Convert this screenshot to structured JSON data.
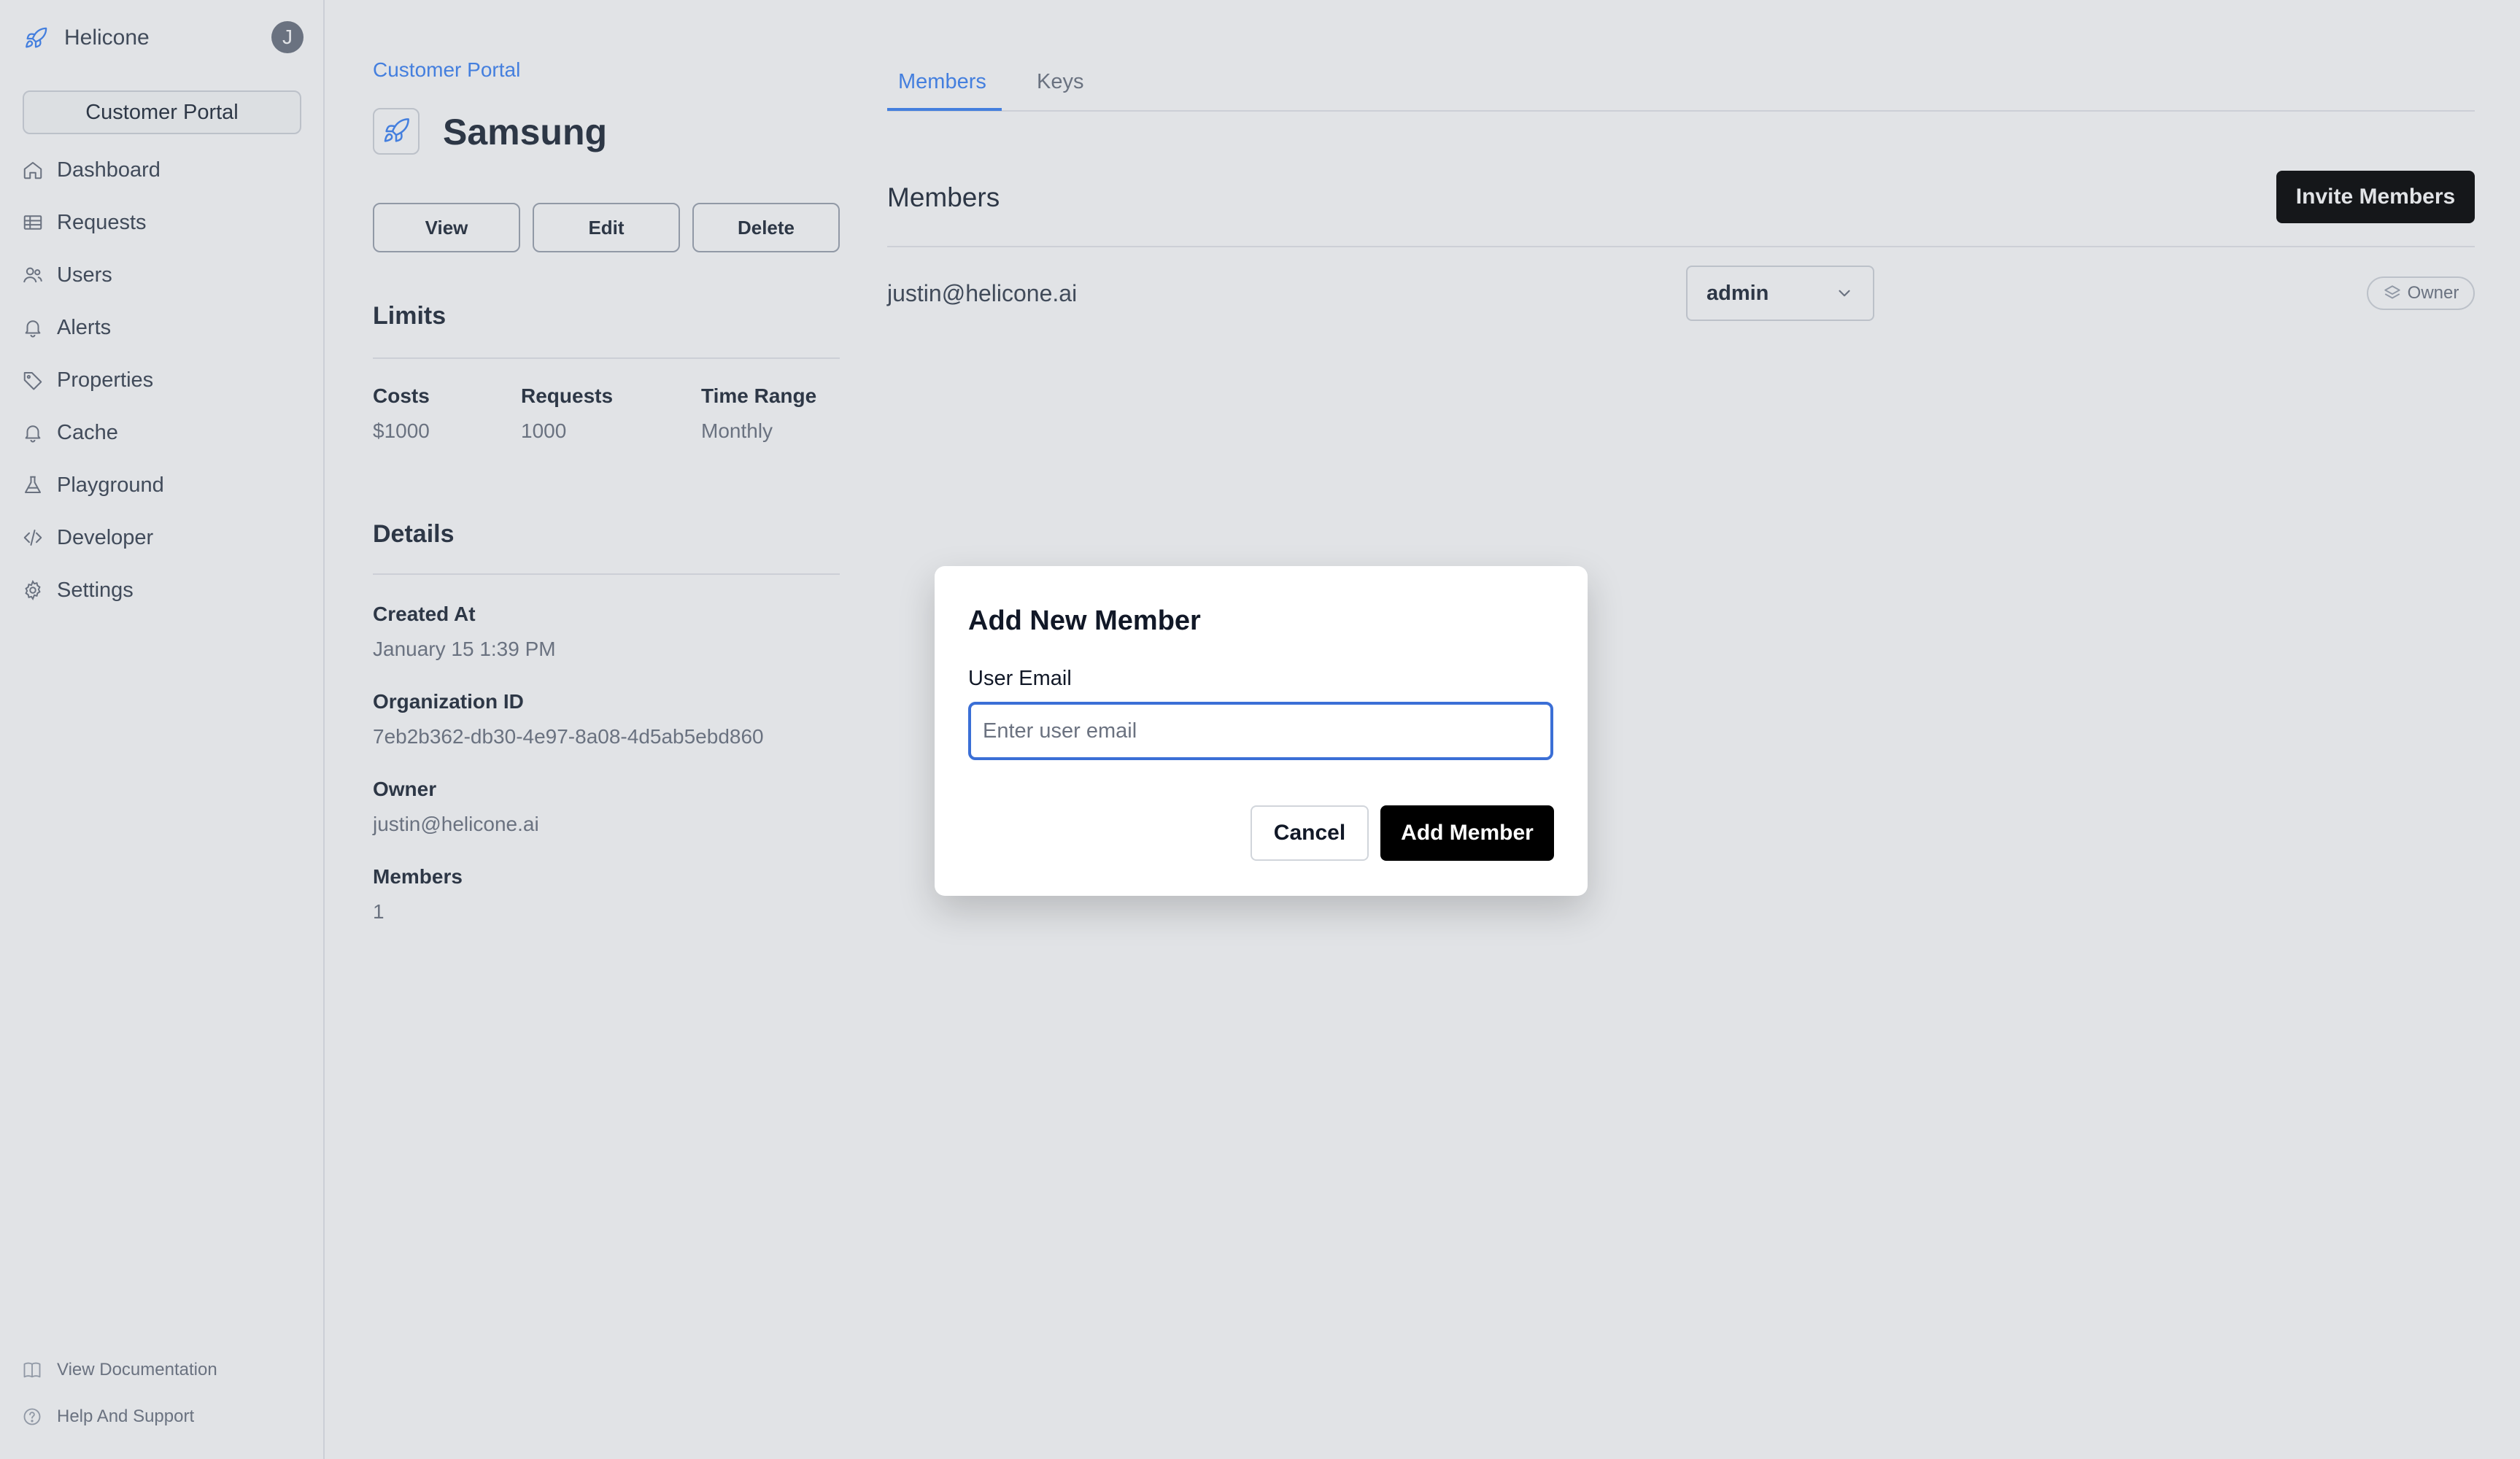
{
  "sidebar": {
    "brand": "Helicone",
    "avatar_initial": "J",
    "portal_button": "Customer Portal",
    "nav": [
      {
        "label": "Dashboard",
        "icon": "home-icon"
      },
      {
        "label": "Requests",
        "icon": "table-icon"
      },
      {
        "label": "Users",
        "icon": "users-icon"
      },
      {
        "label": "Alerts",
        "icon": "bell-icon"
      },
      {
        "label": "Properties",
        "icon": "tag-icon"
      },
      {
        "label": "Cache",
        "icon": "bell-icon"
      },
      {
        "label": "Playground",
        "icon": "flask-icon"
      },
      {
        "label": "Developer",
        "icon": "code-icon"
      },
      {
        "label": "Settings",
        "icon": "gear-icon"
      }
    ],
    "footer": [
      {
        "label": "View Documentation",
        "icon": "book-icon"
      },
      {
        "label": "Help And Support",
        "icon": "help-circle-icon"
      }
    ]
  },
  "org": {
    "breadcrumb": "Customer Portal",
    "name": "Samsung",
    "actions": {
      "view": "View",
      "edit": "Edit",
      "delete": "Delete"
    }
  },
  "limits": {
    "title": "Limits",
    "costs_label": "Costs",
    "costs_value": "$1000",
    "requests_label": "Requests",
    "requests_value": "1000",
    "range_label": "Time Range",
    "range_value": "Monthly"
  },
  "details": {
    "title": "Details",
    "created_label": "Created At",
    "created_value": "January 15 1:39 PM",
    "orgid_label": "Organization ID",
    "orgid_value": "7eb2b362-db30-4e97-8a08-4d5ab5ebd860",
    "owner_label": "Owner",
    "owner_value": "justin@helicone.ai",
    "members_label": "Members",
    "members_value": "1"
  },
  "tabs": {
    "members": "Members",
    "keys": "Keys"
  },
  "members_panel": {
    "title": "Members",
    "invite_button": "Invite Members",
    "rows": [
      {
        "email": "justin@helicone.ai",
        "role": "admin",
        "badge": "Owner"
      }
    ]
  },
  "modal": {
    "title": "Add New Member",
    "email_label": "User Email",
    "email_placeholder": "Enter user email",
    "email_value": "",
    "cancel": "Cancel",
    "submit": "Add Member"
  },
  "colors": {
    "accent": "#3b82f6",
    "primary_button": "#000000"
  }
}
